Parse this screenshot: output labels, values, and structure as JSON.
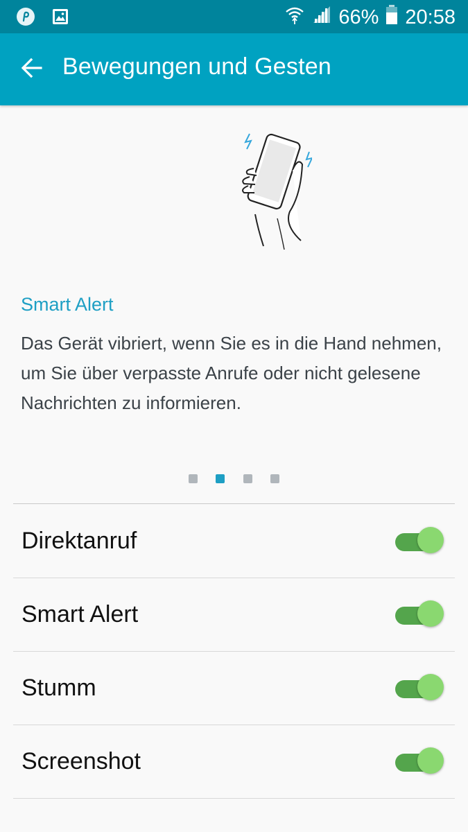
{
  "status_bar": {
    "left_icons": [
      "pinterest-notification-icon",
      "gallery-notification-icon"
    ],
    "right_icons": [
      "wifi-icon",
      "signal-icon",
      "battery-icon"
    ],
    "battery_percent": "66%",
    "time": "20:58"
  },
  "app_bar": {
    "back_icon": "arrow-left-icon",
    "title": "Bewegungen und Gesten"
  },
  "feature": {
    "illustration_icon": "hand-holding-vibrating-phone-icon",
    "title": "Smart Alert",
    "description": "Das Gerät vibriert, wenn Sie es in die Hand nehmen, um Sie über verpasste Anrufe oder nicht gelesene Nachrichten zu informieren."
  },
  "pager": {
    "count": 4,
    "active_index": 1
  },
  "colors": {
    "status_bar": "#00849c",
    "app_bar": "#00a2c1",
    "accent": "#1e9fc4",
    "switch_track_on": "#54a54c",
    "switch_thumb_on": "#8ad870"
  },
  "settings": [
    {
      "label": "Direktanruf",
      "enabled": true
    },
    {
      "label": "Smart Alert",
      "enabled": true
    },
    {
      "label": "Stumm",
      "enabled": true
    },
    {
      "label": "Screenshot",
      "enabled": true
    }
  ]
}
